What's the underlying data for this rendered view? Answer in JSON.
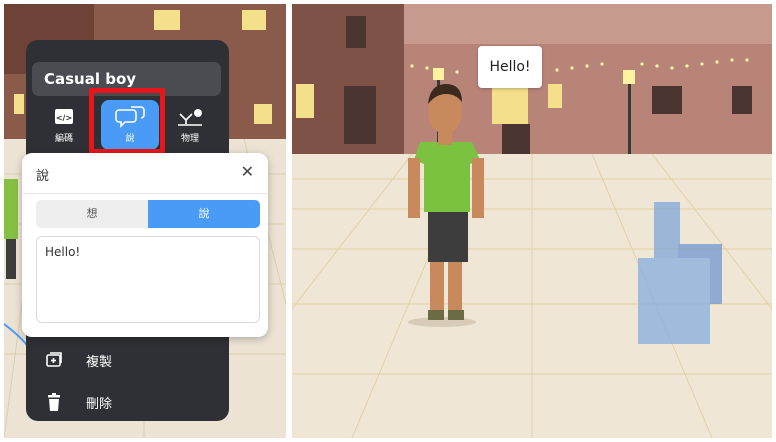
{
  "left_panel": {
    "character_title": "Casual boy",
    "tools": [
      {
        "label": "編碼",
        "icon": "code-icon"
      },
      {
        "label": "說",
        "icon": "speech-bubble-icon"
      },
      {
        "label": "物理",
        "icon": "physics-icon"
      }
    ],
    "say_popup": {
      "title": "說",
      "close_icon": "close-icon",
      "segments": [
        {
          "label": "想",
          "selected": false
        },
        {
          "label": "說",
          "selected": true
        }
      ],
      "text_value": "Hello!"
    },
    "menu_items": [
      {
        "label": "複製",
        "icon": "duplicate-icon"
      },
      {
        "label": "刪除",
        "icon": "trash-icon"
      }
    ]
  },
  "right_panel": {
    "speech_bubble_text": "Hello!"
  },
  "colors": {
    "accent": "#4a9bf6",
    "highlight": "#e8161b",
    "menu_bg": "#2f3035"
  }
}
